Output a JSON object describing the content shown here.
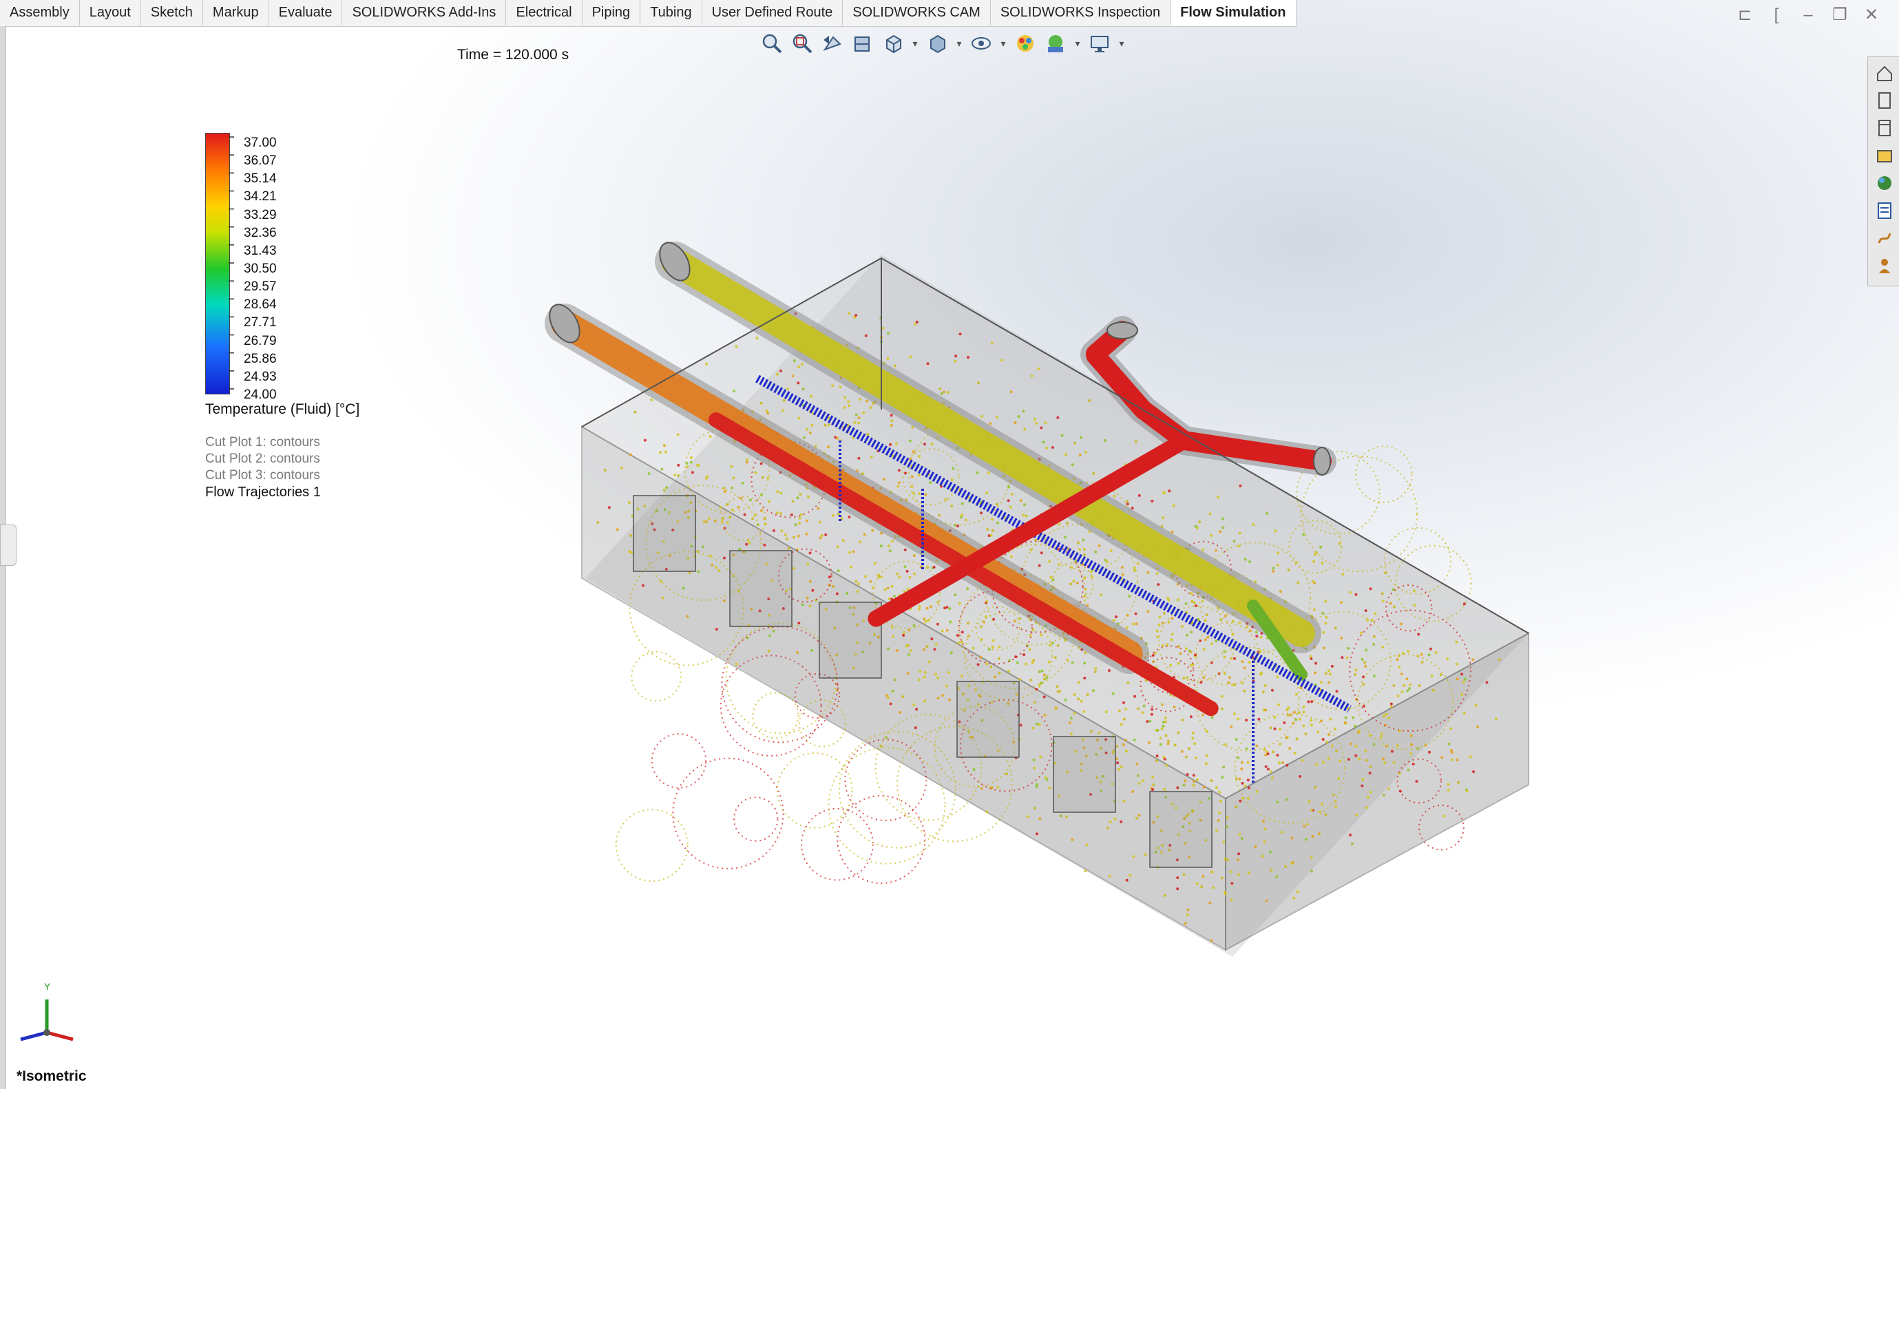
{
  "tabs": [
    {
      "label": "Assembly"
    },
    {
      "label": "Layout"
    },
    {
      "label": "Sketch"
    },
    {
      "label": "Markup"
    },
    {
      "label": "Evaluate"
    },
    {
      "label": "SOLIDWORKS Add-Ins"
    },
    {
      "label": "Electrical"
    },
    {
      "label": "Piping"
    },
    {
      "label": "Tubing"
    },
    {
      "label": "User Defined Route"
    },
    {
      "label": "SOLIDWORKS CAM"
    },
    {
      "label": "SOLIDWORKS Inspection"
    },
    {
      "label": "Flow Simulation",
      "active": true
    }
  ],
  "window_controls": [
    "restore-left-icon",
    "pin-icon",
    "minimize-icon",
    "maximize-icon",
    "close-icon"
  ],
  "time_label": "Time = 120.000 s",
  "heads_up_toolbar": [
    "zoom-to-fit-icon",
    "zoom-to-area-icon",
    "previous-view-icon",
    "section-view-icon",
    "view-orientation-icon",
    "display-style-icon",
    "hide-show-items-icon",
    "edit-appearance-icon",
    "apply-scene-icon",
    "view-settings-icon"
  ],
  "legend": {
    "values": [
      "37.00",
      "36.07",
      "35.14",
      "34.21",
      "33.29",
      "32.36",
      "31.43",
      "30.50",
      "29.57",
      "28.64",
      "27.71",
      "26.79",
      "25.86",
      "24.93",
      "24.00"
    ],
    "title": "Temperature (Fluid) [°C]",
    "colors": {
      "max": "#e11a1a",
      "mid": "#22c82a",
      "min": "#1020d0"
    }
  },
  "plot_list": {
    "cut_plots": [
      "Cut Plot 1: contours",
      "Cut Plot 2: contours",
      "Cut Plot 3: contours"
    ],
    "trajectories": "Flow Trajectories 1"
  },
  "triad": {
    "y_label": "Y"
  },
  "view_label": "*Isometric"
}
